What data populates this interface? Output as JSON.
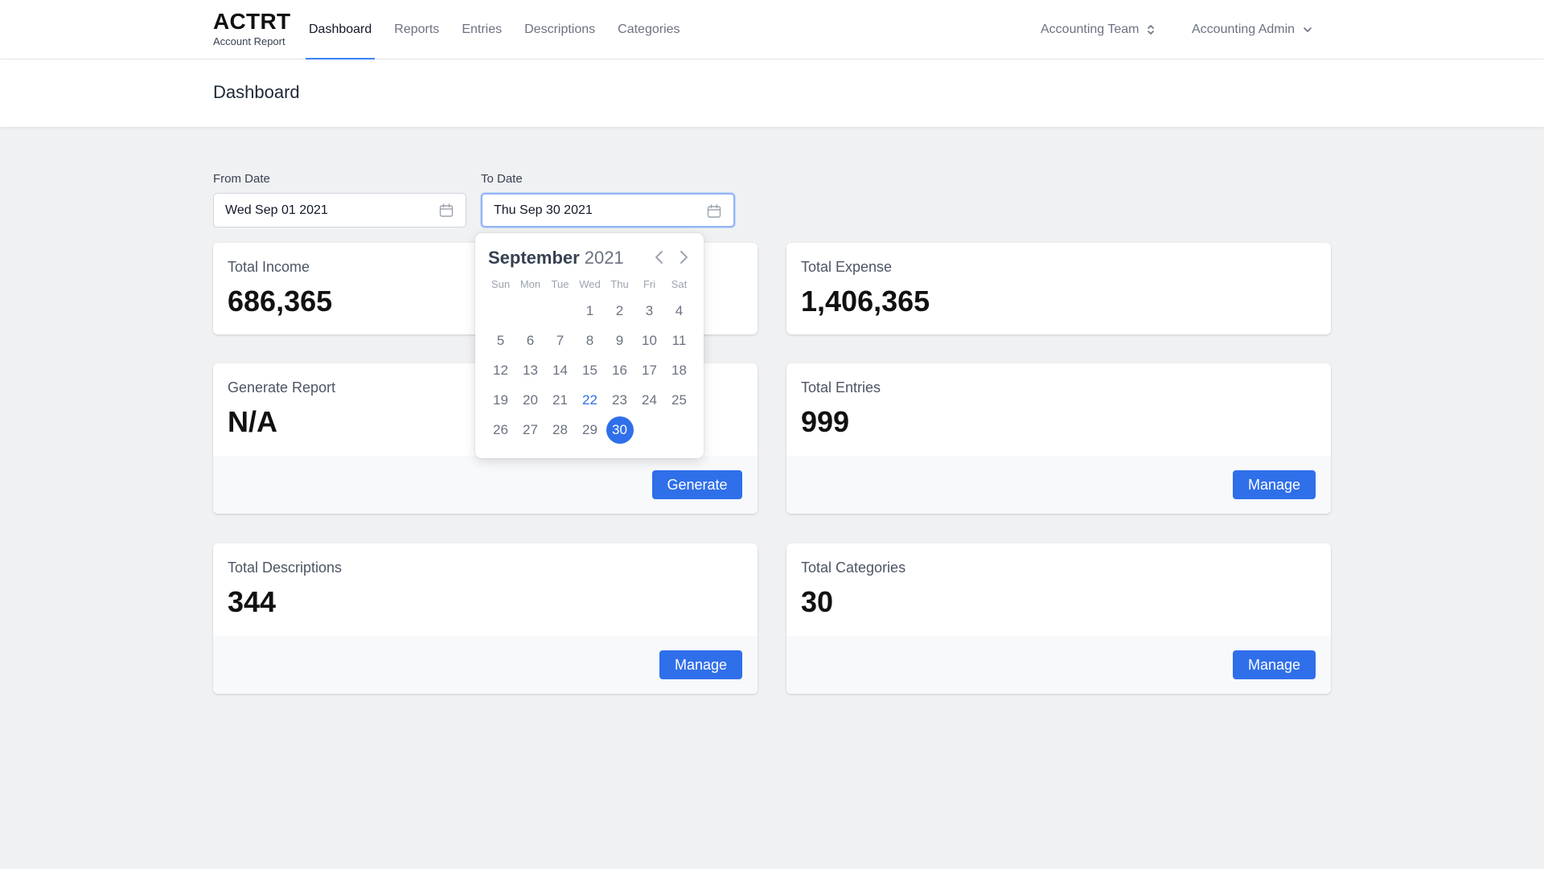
{
  "brand": {
    "title": "ACTRT",
    "subtitle": "Account Report"
  },
  "nav": {
    "items": [
      {
        "label": "Dashboard",
        "active": true
      },
      {
        "label": "Reports"
      },
      {
        "label": "Entries"
      },
      {
        "label": "Descriptions"
      },
      {
        "label": "Categories"
      }
    ],
    "team": "Accounting Team",
    "user": "Accounting Admin"
  },
  "page": {
    "title": "Dashboard"
  },
  "filters": {
    "from_label": "From Date",
    "from_value": "Wed Sep 01 2021",
    "to_label": "To Date",
    "to_value": "Thu Sep 30 2021"
  },
  "calendar": {
    "month": "September",
    "year": "2021",
    "weekdays": [
      "Sun",
      "Mon",
      "Tue",
      "Wed",
      "Thu",
      "Fri",
      "Sat"
    ],
    "weeks": [
      [
        "",
        "",
        "",
        "1",
        "2",
        "3",
        "4"
      ],
      [
        "5",
        "6",
        "7",
        "8",
        "9",
        "10",
        "11"
      ],
      [
        "12",
        "13",
        "14",
        "15",
        "16",
        "17",
        "18"
      ],
      [
        "19",
        "20",
        "21",
        "22",
        "23",
        "24",
        "25"
      ],
      [
        "26",
        "27",
        "28",
        "29",
        "30",
        "",
        ""
      ]
    ],
    "today": "22",
    "selected": "30"
  },
  "cards": {
    "income": {
      "label": "Total Income",
      "value": "686,365"
    },
    "expense": {
      "label": "Total Expense",
      "value": "1,406,365"
    },
    "report": {
      "label": "Generate Report",
      "value": "N/A",
      "button": "Generate"
    },
    "entries": {
      "label": "Total Entries",
      "value": "999",
      "button": "Manage"
    },
    "descriptions": {
      "label": "Total Descriptions",
      "value": "344",
      "button": "Manage"
    },
    "categories": {
      "label": "Total Categories",
      "value": "30",
      "button": "Manage"
    }
  },
  "colors": {
    "accent": "#2f6fe9",
    "background": "#f0f1f3"
  }
}
